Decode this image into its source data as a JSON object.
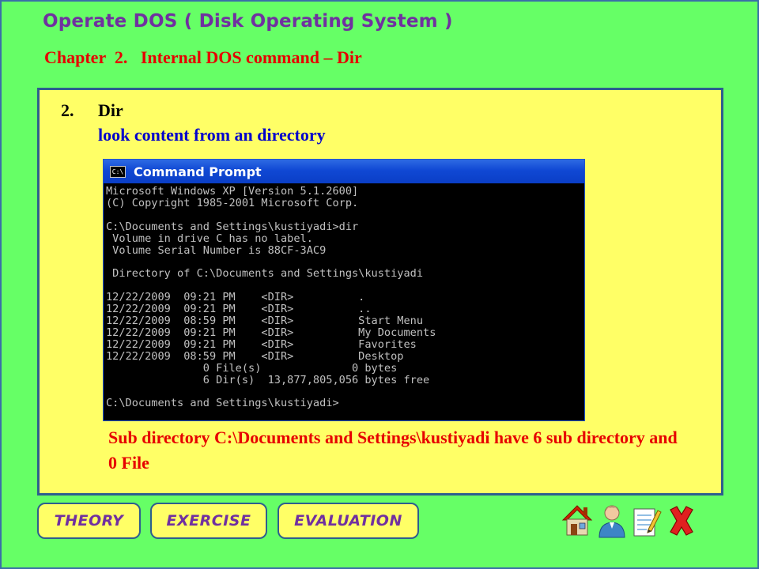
{
  "header": {
    "title": "Operate DOS ( Disk Operating System )",
    "chapter": "Chapter  2.   Internal DOS command – Dir"
  },
  "item": {
    "number": "2.",
    "title": "Dir",
    "description": "look content from an directory"
  },
  "command_prompt": {
    "window_title": "Command Prompt",
    "icon_label": "C:\\",
    "output": "Microsoft Windows XP [Version 5.1.2600]\n(C) Copyright 1985-2001 Microsoft Corp.\n\nC:\\Documents and Settings\\kustiyadi>dir\n Volume in drive C has no label.\n Volume Serial Number is 88CF-3AC9\n\n Directory of C:\\Documents and Settings\\kustiyadi\n\n12/22/2009  09:21 PM    <DIR>          .\n12/22/2009  09:21 PM    <DIR>          ..\n12/22/2009  08:59 PM    <DIR>          Start Menu\n12/22/2009  09:21 PM    <DIR>          My Documents\n12/22/2009  09:21 PM    <DIR>          Favorites\n12/22/2009  08:59 PM    <DIR>          Desktop\n               0 File(s)              0 bytes\n               6 Dir(s)  13,877,805,056 bytes free\n\nC:\\Documents and Settings\\kustiyadi>"
  },
  "note": "Sub directory C:\\Documents and Settings\\kustiyadi have 6 sub directory and  0 File",
  "nav": {
    "theory": "THEORY",
    "exercise": "EXERCISE",
    "evaluation": "EVALUATION",
    "icons": [
      "home-icon",
      "user-icon",
      "notepad-icon",
      "close-icon"
    ]
  },
  "colors": {
    "background": "#66ff66",
    "panel": "#ffff66",
    "title": "#7030a0",
    "chapter": "#e60000",
    "description": "#0000cc",
    "border": "#2e5e8e"
  }
}
